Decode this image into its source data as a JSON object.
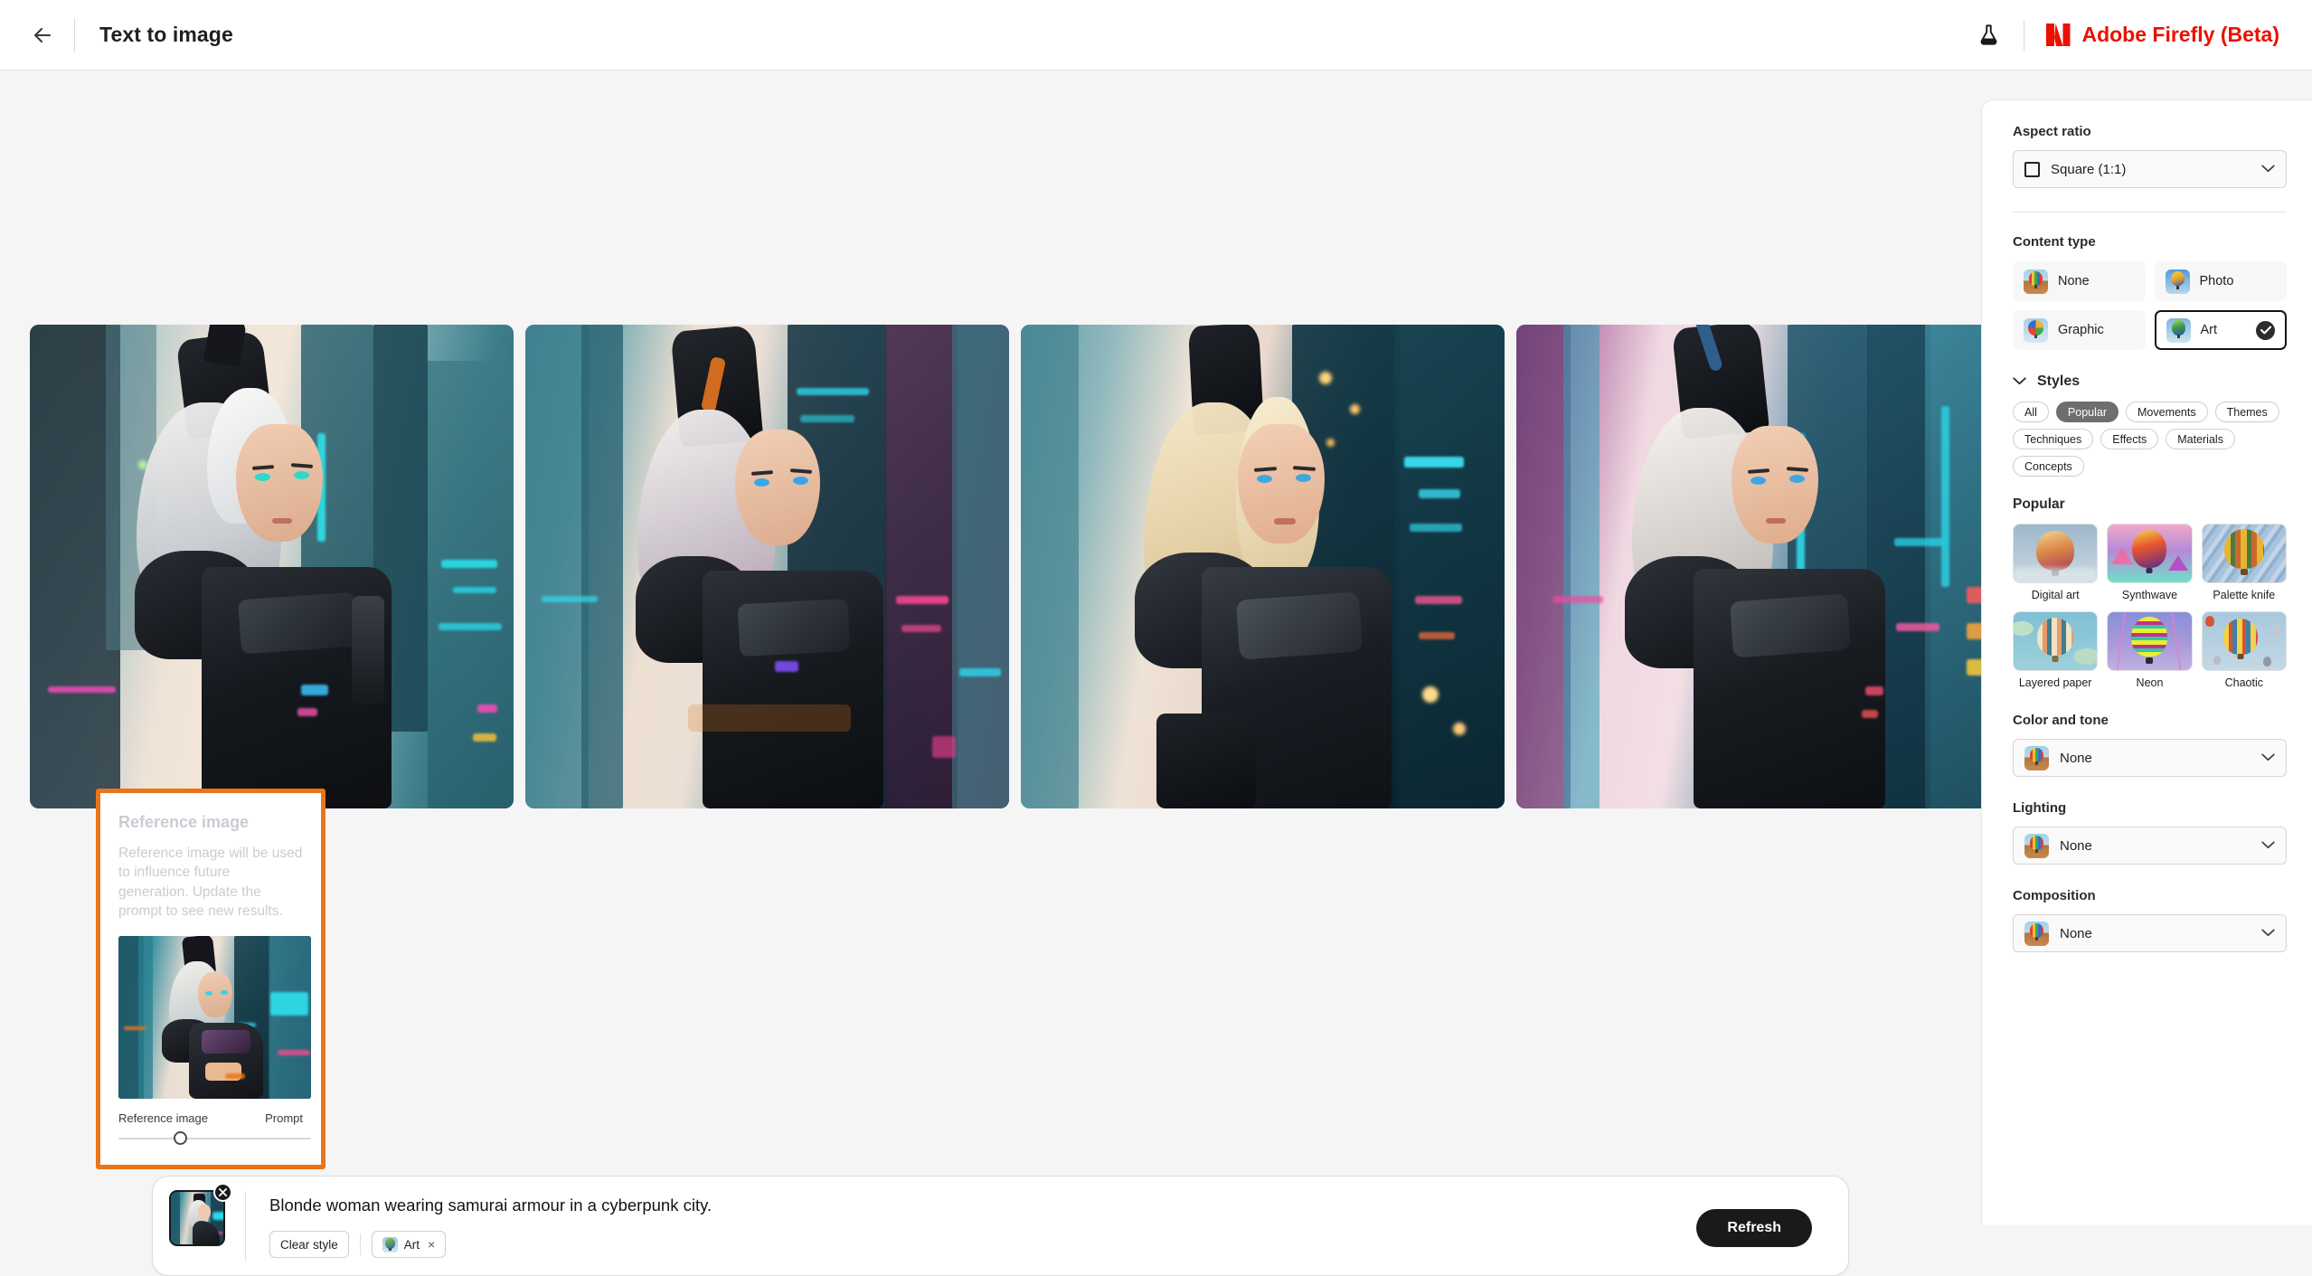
{
  "topbar": {
    "back_icon": "arrow-left-icon",
    "title": "Text to image",
    "beaker_icon": "beaker-icon",
    "brand_logo_icon": "adobe-logo-icon",
    "brand_name": "Adobe Firefly (Beta)",
    "brand_color": "#eb1000"
  },
  "results": {
    "count": 4,
    "images": [
      {
        "alt": "generated-image-1"
      },
      {
        "alt": "generated-image-2"
      },
      {
        "alt": "generated-image-3"
      },
      {
        "alt": "generated-image-4"
      }
    ]
  },
  "reference_popover": {
    "title": "Reference image",
    "description": "Reference image will be used to influence future generation. Update the prompt to see new results.",
    "slider_left_label": "Reference image",
    "slider_right_label": "Prompt",
    "slider_value_pct": 32,
    "border_color": "#e8751a"
  },
  "prompt_bar": {
    "thumb_name": "reference-thumbnail",
    "remove_icon": "close-icon",
    "prompt_text": "Blonde woman wearing samurai armour in a cyberpunk city.",
    "clear_style_label": "Clear style",
    "style_chip_label": "Art",
    "style_chip_remove": "×",
    "refresh_label": "Refresh"
  },
  "panel": {
    "aspect_ratio": {
      "label": "Aspect ratio",
      "value": "Square (1:1)",
      "icon": "square-icon",
      "chevron": "chevron-down-icon"
    },
    "content_type": {
      "label": "Content type",
      "options": [
        {
          "label": "None",
          "selected": false
        },
        {
          "label": "Photo",
          "selected": false
        },
        {
          "label": "Graphic",
          "selected": false
        },
        {
          "label": "Art",
          "selected": true
        }
      ],
      "check_icon": "check-circle-icon"
    },
    "styles": {
      "label": "Styles",
      "collapse_icon": "chevron-down-icon",
      "filters": [
        {
          "label": "All",
          "active": false
        },
        {
          "label": "Popular",
          "active": true
        },
        {
          "label": "Movements",
          "active": false
        },
        {
          "label": "Themes",
          "active": false
        },
        {
          "label": "Techniques",
          "active": false
        },
        {
          "label": "Effects",
          "active": false
        },
        {
          "label": "Materials",
          "active": false
        },
        {
          "label": "Concepts",
          "active": false
        }
      ],
      "group_label": "Popular",
      "items": [
        {
          "label": "Digital art"
        },
        {
          "label": "Synthwave"
        },
        {
          "label": "Palette knife"
        },
        {
          "label": "Layered paper"
        },
        {
          "label": "Neon"
        },
        {
          "label": "Chaotic"
        }
      ]
    },
    "color_and_tone": {
      "label": "Color and tone",
      "value": "None",
      "chevron": "chevron-down-icon"
    },
    "lighting": {
      "label": "Lighting",
      "value": "None",
      "chevron": "chevron-down-icon"
    },
    "composition": {
      "label": "Composition",
      "value": "None",
      "chevron": "chevron-down-icon"
    }
  }
}
